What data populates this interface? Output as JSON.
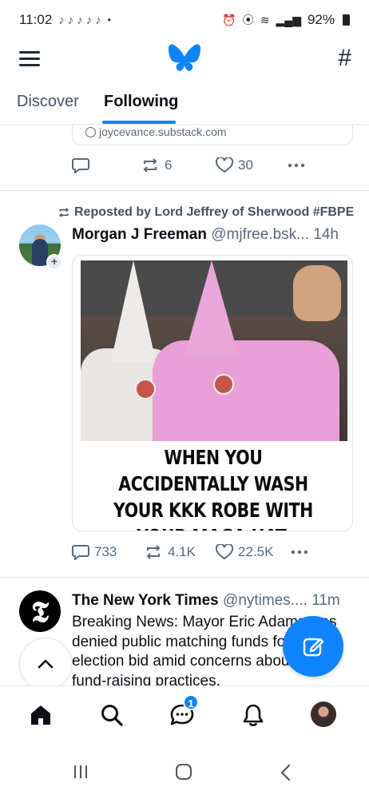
{
  "status_bar": {
    "time": "11:02",
    "notification_icons": [
      "tiktok-icon",
      "tiktok-icon",
      "tiktok-icon",
      "tiktok-icon",
      "tiktok-icon"
    ],
    "dot": "•",
    "battery": "92%"
  },
  "header": {
    "menu_icon": "hamburger-menu-icon",
    "logo": "bluesky-butterfly-logo",
    "feeds_icon": "#"
  },
  "tabs": [
    {
      "label": "Discover",
      "active": false
    },
    {
      "label": "Following",
      "active": true
    }
  ],
  "feed": {
    "previous_post": {
      "link_url": "joycevance.substack.com",
      "replies": "",
      "reposts": "6",
      "likes": "30"
    },
    "post_1": {
      "repost_label": "Reposted by Lord Jeffrey of Sherwood #FBPE",
      "author_name": "Morgan J Freeman",
      "author_handle": "@mjfree.bsk...",
      "timestamp": "14h",
      "image_caption": "WHEN YOU ACCIDENTALLY WASH YOUR KKK ROBE WITH YOUR MAGA HAT.",
      "replies": "733",
      "reposts": "4.1K",
      "likes": "22.5K"
    },
    "post_2": {
      "author_name": "The New York Times",
      "author_handle": "@nytimes....",
      "timestamp": "11m",
      "text": "Breaking News: Mayor Eric Adams was denied public matching funds for his re-election bid amid concerns about his fund-raising practices."
    }
  },
  "bottom_nav": {
    "items": [
      "home-icon",
      "search-icon",
      "chat-icon",
      "notifications-icon",
      "profile-avatar"
    ],
    "chat_badge": "1"
  },
  "colors": {
    "accent": "#1083fe",
    "text": "#0b0f14",
    "muted": "#5b6a79"
  }
}
